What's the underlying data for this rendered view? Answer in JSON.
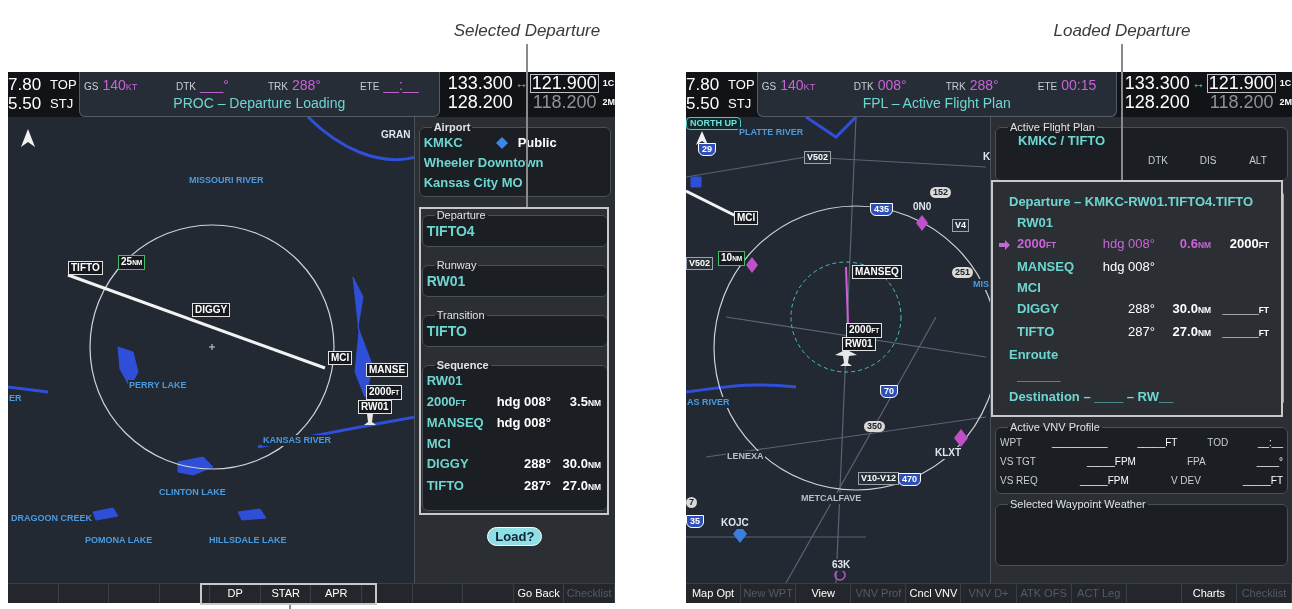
{
  "annotations": [
    {
      "text": "Selected Departure"
    },
    {
      "text": "Loaded Departure"
    }
  ],
  "screens": [
    {
      "header": {
        "left_rows": [
          {
            "number": "7.80",
            "waypoint": "TOP"
          },
          {
            "number": "5.50",
            "waypoint": "STJ"
          }
        ],
        "fields": [
          {
            "label": "GS",
            "value": "140",
            "unit": "KT"
          },
          {
            "label": "DTK",
            "value": "___°"
          },
          {
            "label": "TRK",
            "value": "288°"
          },
          {
            "label": "ETE",
            "value": "__:__"
          }
        ],
        "title": "PROC – Departure Loading",
        "com": [
          {
            "active": "133.300",
            "swap": "↔",
            "standby": "121.900",
            "channel": "1C"
          },
          {
            "active": "128.200",
            "standby": "118.200",
            "channel": "2M"
          }
        ]
      },
      "map": {
        "labels": [
          {
            "text": "GRAN",
            "kind": "place"
          },
          {
            "text": "MISSOURI RIVER",
            "kind": "water"
          },
          {
            "text": "TIFTO",
            "kind": "waypoint"
          },
          {
            "text": "25",
            "unit": "NM",
            "kind": "distance"
          },
          {
            "text": "DIGGY",
            "kind": "waypoint"
          },
          {
            "text": "MCI",
            "kind": "waypoint"
          },
          {
            "text": "MANSE",
            "kind": "waypoint"
          },
          {
            "text": "2000",
            "unit": "FT",
            "kind": "waypoint"
          },
          {
            "text": "RW01",
            "kind": "waypoint"
          },
          {
            "text": "ER",
            "kind": "water"
          },
          {
            "text": "PERRY LAKE",
            "kind": "water"
          },
          {
            "text": "KANSAS RIVER",
            "kind": "water"
          },
          {
            "text": "CLINTON LAKE",
            "kind": "water"
          },
          {
            "text": "DRAGOON CREEK",
            "kind": "water"
          },
          {
            "text": "POMONA LAKE",
            "kind": "water"
          },
          {
            "text": "HILLSDALE LAKE",
            "kind": "water"
          }
        ]
      },
      "panel": {
        "kind": "procedure",
        "airport": {
          "title": "Airport",
          "ident": "KMKC",
          "type": "Public",
          "name": "Wheeler Downtown",
          "city": "Kansas City MO"
        },
        "selections": [
          {
            "title": "Departure",
            "value": "TIFTO4"
          },
          {
            "title": "Runway",
            "value": "RW01"
          },
          {
            "title": "Transition",
            "value": "TIFTO"
          }
        ],
        "sequence": {
          "title": "Sequence",
          "rows": [
            {
              "name": "RW01"
            },
            {
              "name": "2000",
              "name_unit": "FT",
              "course": "hdg 008°",
              "dist": "3.5",
              "dist_unit": "NM"
            },
            {
              "name": "MANSEQ",
              "course": "hdg 008°"
            },
            {
              "name": "MCI"
            },
            {
              "name": "DIGGY",
              "course": "288°",
              "dist": "30.0",
              "dist_unit": "NM"
            },
            {
              "name": "TIFTO",
              "course": "287°",
              "dist": "27.0",
              "dist_unit": "NM"
            }
          ]
        },
        "button": "Load?"
      },
      "softkeys": [
        {
          "kind": "blank"
        },
        {
          "kind": "blank"
        },
        {
          "kind": "blank"
        },
        {
          "kind": "blank"
        },
        {
          "kind": "key",
          "label": "DP",
          "disabled": false
        },
        {
          "kind": "key",
          "label": "STAR",
          "disabled": false
        },
        {
          "kind": "key",
          "label": "APR",
          "disabled": false
        },
        {
          "kind": "blank"
        },
        {
          "kind": "blank"
        },
        {
          "kind": "blank"
        },
        {
          "kind": "key",
          "label": "Go Back",
          "disabled": false
        },
        {
          "kind": "key",
          "label": "Checklist",
          "disabled": true
        }
      ]
    },
    {
      "header": {
        "left_rows": [
          {
            "number": "7.80",
            "waypoint": "TOP"
          },
          {
            "number": "5.50",
            "waypoint": "STJ"
          }
        ],
        "fields": [
          {
            "label": "GS",
            "value": "140",
            "unit": "KT"
          },
          {
            "label": "DTK",
            "value": "008°"
          },
          {
            "label": "TRK",
            "value": "288°"
          },
          {
            "label": "ETE",
            "value": "00:15"
          }
        ],
        "title": "FPL – Active Flight Plan",
        "com": [
          {
            "active": "133.300",
            "swap": "↔",
            "standby": "121.900",
            "channel": "1C"
          },
          {
            "active": "128.200",
            "standby": "118.200",
            "channel": "2M"
          }
        ]
      },
      "map": {
        "labels": [
          {
            "text": "NORTH UP",
            "kind": "status"
          },
          {
            "text": "PLATTE RIVER",
            "kind": "water"
          },
          {
            "text": "29",
            "kind": "shield"
          },
          {
            "text": "V502",
            "kind": "airway"
          },
          {
            "text": "K",
            "kind": "place"
          },
          {
            "text": "435",
            "kind": "shield"
          },
          {
            "text": "0N0",
            "kind": "place"
          },
          {
            "text": "152",
            "kind": "highway"
          },
          {
            "text": "V4",
            "kind": "airway"
          },
          {
            "text": "MCI",
            "kind": "waypoint"
          },
          {
            "text": "10",
            "unit": "NM",
            "kind": "distance"
          },
          {
            "text": "V502",
            "kind": "airway"
          },
          {
            "text": "MANSEQ",
            "kind": "waypoint"
          },
          {
            "text": "251",
            "kind": "highway"
          },
          {
            "text": "MIS",
            "kind": "water"
          },
          {
            "text": "2000",
            "unit": "FT",
            "kind": "waypoint"
          },
          {
            "text": "RW01",
            "kind": "waypoint"
          },
          {
            "text": "AS RIVER",
            "kind": "water"
          },
          {
            "text": "70",
            "kind": "shield"
          },
          {
            "text": "350",
            "kind": "highway"
          },
          {
            "text": "KLXT",
            "kind": "place"
          },
          {
            "text": "LENEXA",
            "kind": "city"
          },
          {
            "text": "V10-V12",
            "kind": "airway"
          },
          {
            "text": "470",
            "kind": "shield"
          },
          {
            "text": "METCALFAVE",
            "kind": "city"
          },
          {
            "text": "7",
            "kind": "highway"
          },
          {
            "text": "35",
            "kind": "shield"
          },
          {
            "text": "KOJC",
            "kind": "place"
          },
          {
            "text": "63K",
            "kind": "place"
          }
        ]
      },
      "panel": {
        "kind": "flight_plan",
        "plan": {
          "title": "Active Flight Plan",
          "route": "KMKC / TIFTO",
          "columns": [
            "DTK",
            "DIS",
            "ALT"
          ],
          "items": [
            {
              "kind": "heading",
              "text": "Departure – KMKC-RW01.TIFTO4.TIFTO"
            },
            {
              "kind": "leg",
              "name": "RW01",
              "active": false
            },
            {
              "kind": "leg",
              "name": "2000",
              "name_unit": "FT",
              "dtk": "hdg 008°",
              "dis": "0.6",
              "dis_unit": "NM",
              "alt": "2000",
              "alt_unit": "FT",
              "active": true
            },
            {
              "kind": "leg",
              "name": "MANSEQ",
              "dtk": "hdg 008°",
              "active": false
            },
            {
              "kind": "leg",
              "name": "MCI",
              "active": false
            },
            {
              "kind": "leg",
              "name": "DIGGY",
              "dtk": "288°",
              "dis": "30.0",
              "dis_unit": "NM",
              "alt": "_____",
              "alt_unit": "FT",
              "active": false
            },
            {
              "kind": "leg",
              "name": "TIFTO",
              "dtk": "287°",
              "dis": "27.0",
              "dis_unit": "NM",
              "alt": "_____",
              "alt_unit": "FT",
              "active": false
            },
            {
              "kind": "heading",
              "text": "Enroute"
            },
            {
              "kind": "leg",
              "name": "______",
              "active": false
            },
            {
              "kind": "heading",
              "text": "Destination – ____ – RW__"
            }
          ]
        },
        "vnv": {
          "title": "Active VNV Profile",
          "rows": [
            [
              {
                "kind": "label",
                "text": "WPT"
              },
              {
                "kind": "value",
                "text": "__________"
              },
              {
                "kind": "value",
                "text": "_____FT"
              },
              {
                "kind": "label",
                "text": "TOD"
              },
              {
                "kind": "value",
                "text": "__:__"
              }
            ],
            [
              {
                "kind": "label",
                "text": "VS TGT"
              },
              {
                "kind": "value",
                "text": "_____FPM"
              },
              {
                "kind": "label",
                "text": "FPA"
              },
              {
                "kind": "value",
                "text": "____°"
              }
            ],
            [
              {
                "kind": "label",
                "text": "VS REQ"
              },
              {
                "kind": "value",
                "text": "_____FPM"
              },
              {
                "kind": "label",
                "text": "V DEV"
              },
              {
                "kind": "value",
                "text": "_____FT"
              }
            ]
          ]
        },
        "weather": {
          "title": "Selected Waypoint Weather"
        }
      },
      "softkeys": [
        {
          "kind": "key",
          "label": "Map Opt",
          "disabled": false
        },
        {
          "kind": "key",
          "label": "New WPT",
          "disabled": true
        },
        {
          "kind": "key",
          "label": "View",
          "disabled": false
        },
        {
          "kind": "key",
          "label": "VNV Prof",
          "disabled": true
        },
        {
          "kind": "key",
          "label": "Cncl VNV",
          "disabled": false
        },
        {
          "kind": "key",
          "label": "VNV D+",
          "disabled": true
        },
        {
          "kind": "key",
          "label": "ATK OFS",
          "disabled": true
        },
        {
          "kind": "key",
          "label": "ACT Leg",
          "disabled": true
        },
        {
          "kind": "blank"
        },
        {
          "kind": "key",
          "label": "Charts",
          "disabled": false
        },
        {
          "kind": "key",
          "label": "Checklist",
          "disabled": true
        }
      ]
    }
  ]
}
